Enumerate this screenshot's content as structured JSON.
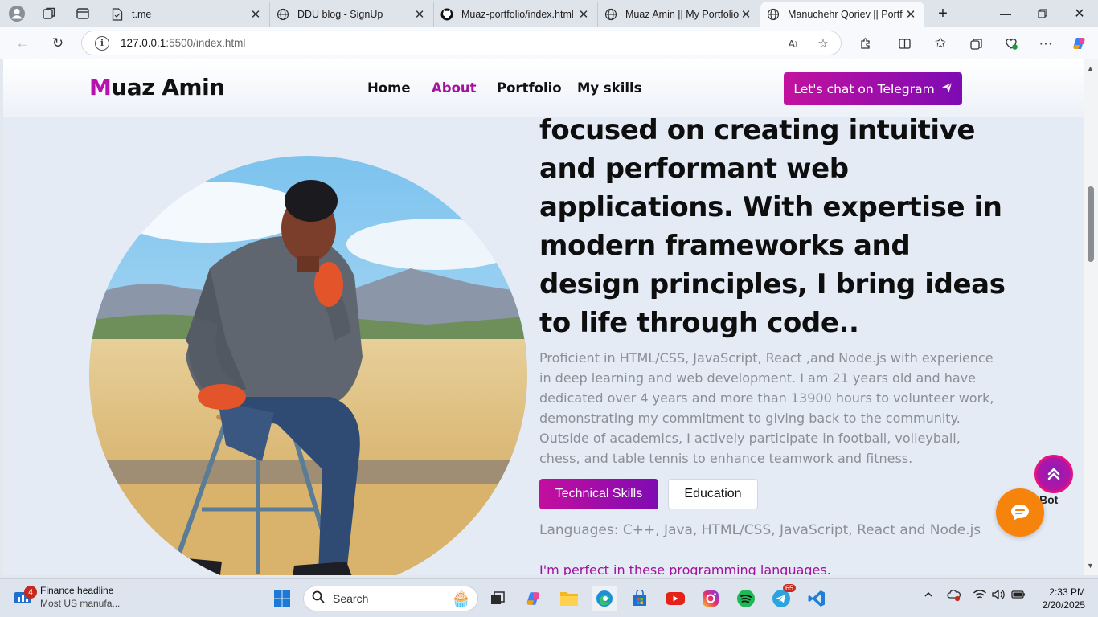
{
  "browser": {
    "tabs": [
      {
        "title": "t.me",
        "icon": "page-icon"
      },
      {
        "title": "DDU blog - SignUp",
        "icon": "globe-icon"
      },
      {
        "title": "Muaz-portfolio/index.html",
        "icon": "github-icon"
      },
      {
        "title": "Muaz Amin || My Portfolio",
        "icon": "globe-icon"
      },
      {
        "title": "Manuchehr Qoriev || Portfo",
        "icon": "globe-icon"
      }
    ],
    "address": {
      "host": "127.0.0.1",
      "rest": ":5500/index.html"
    }
  },
  "site": {
    "logo_first": "M",
    "logo_rest": "uaz Amin",
    "nav": [
      "Home",
      "About",
      "Portfolio",
      "My skills"
    ],
    "active_nav": "About",
    "cta_label": "Let's chat on Telegram",
    "heading": "focused on creating intuitive and performant web applications. With expertise in modern frameworks and design principles, I bring ideas to life through code..",
    "paragraph": "Proficient in HTML/CSS, JavaScript, React ,and Node.js with experience in deep learning and web development. I am 21 years old and have dedicated over 4 years and more than 13900 hours to volunteer work, demonstrating my commitment to giving back to the community. Outside of academics, I actively participate in football, volleyball, chess, and table tennis to enhance teamwork and fitness.",
    "btn_skills": "Technical Skills",
    "btn_education": "Education",
    "languages": "Languages: C++, Java, HTML/CSS, JavaScript, React and Node.js",
    "perfect": "I'm perfect in these programming languages.",
    "bot_label": "Bot"
  },
  "taskbar": {
    "widget_badge": "4",
    "widget_title": "Finance headline",
    "widget_sub": "Most US manufa...",
    "search_label": "Search",
    "telegram_badge": "65",
    "time": "2:33 PM",
    "date": "2/20/2025"
  },
  "colors": {
    "accent": "#b512ae",
    "cta_start": "#c2129e",
    "cta_end": "#7d0bb3",
    "chat": "#f5830c"
  }
}
